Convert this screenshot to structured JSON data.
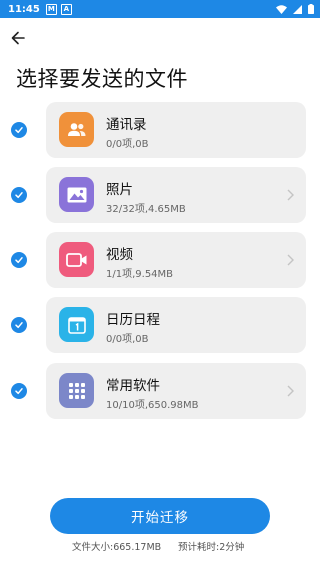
{
  "status_bar": {
    "time": "11:45",
    "notif_icons": [
      "M",
      "A"
    ]
  },
  "header": {
    "title": "选择要发送的文件"
  },
  "items": [
    {
      "title": "通讯录",
      "subtitle": "0/0项,0B",
      "checked": true,
      "icon": "contacts-icon",
      "icon_color": "#f0913a"
    },
    {
      "title": "照片",
      "subtitle": "32/32项,4.65MB",
      "checked": true,
      "icon": "photo-icon",
      "icon_color": "#8a73d9"
    },
    {
      "title": "视频",
      "subtitle": "1/1项,9.54MB",
      "checked": true,
      "icon": "video-icon",
      "icon_color": "#ef5b7d"
    },
    {
      "title": "日历日程",
      "subtitle": "0/0项,0B",
      "checked": true,
      "icon": "calendar-icon",
      "icon_color": "#2ab3e8"
    },
    {
      "title": "常用软件",
      "subtitle": "10/10项,650.98MB",
      "checked": true,
      "icon": "apps-grid-icon",
      "icon_color": "#7c87c9"
    }
  ],
  "footer": {
    "start_button": "开始迁移",
    "total_size": "文件大小:665.17MB",
    "estimated_time": "预计耗时:2分钟"
  },
  "colors": {
    "accent": "#1e88e5",
    "card_bg": "#efefef"
  }
}
